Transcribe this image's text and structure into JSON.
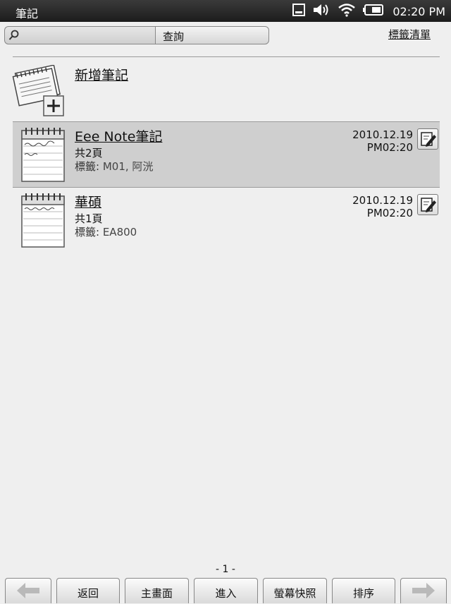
{
  "statusbar": {
    "title": "筆記",
    "time": "02:20 PM"
  },
  "search": {
    "value": "",
    "button_label": "查詢"
  },
  "header": {
    "tag_list_label": "標籤清單"
  },
  "new_note": {
    "label": "新增筆記"
  },
  "notes": [
    {
      "name": "Eee Note筆記",
      "pages": "共2頁",
      "tag_label": "標籤:",
      "tags": " M01, 阿洸",
      "date": "2010.12.19",
      "time": "PM02:20",
      "selected": true
    },
    {
      "name": "華碩",
      "pages": "共1頁",
      "tag_label": "標籤:",
      "tags": " EA800",
      "date": "2010.12.19",
      "time": "PM02:20",
      "selected": false
    }
  ],
  "pager": {
    "label": "- 1 -"
  },
  "toolbar": {
    "back_label": "返回",
    "home_label": "主畫面",
    "enter_label": "進入",
    "screenshot_label": "螢幕快照",
    "sort_label": "排序"
  },
  "icons": {
    "prev": "arrow-left-icon",
    "next": "arrow-right-icon",
    "search": "magnifier-icon",
    "edit": "edit-pencil-icon"
  }
}
